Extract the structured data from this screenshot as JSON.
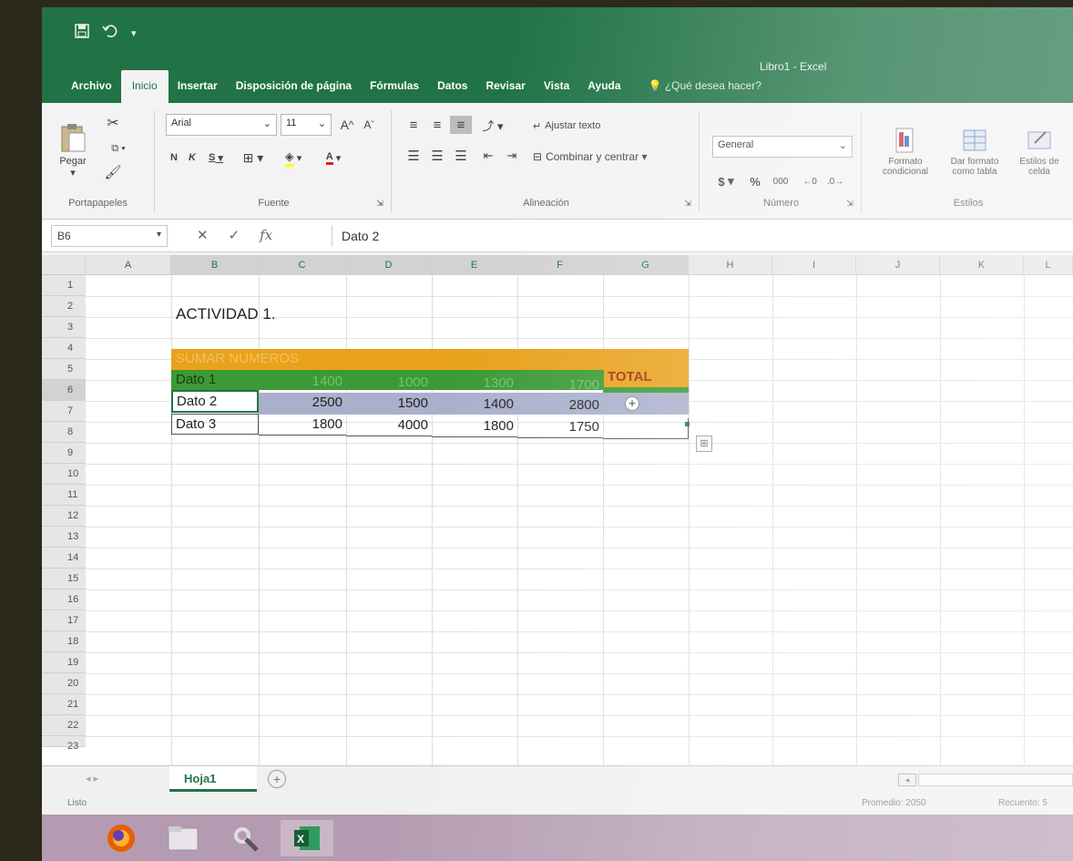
{
  "app": {
    "doc_title": "Libro1 - Excel"
  },
  "qat": {
    "save_icon": "save-icon",
    "undo_icon": "undo-icon"
  },
  "tabs": [
    {
      "label": "Archivo"
    },
    {
      "label": "Inicio"
    },
    {
      "label": "Insertar"
    },
    {
      "label": "Disposición de página"
    },
    {
      "label": "Fórmulas"
    },
    {
      "label": "Datos"
    },
    {
      "label": "Revisar"
    },
    {
      "label": "Vista"
    },
    {
      "label": "Ayuda"
    }
  ],
  "tell_me": "¿Qué desea hacer?",
  "ribbon": {
    "clipboard": {
      "label": "Portapapeles",
      "paste": "Pegar"
    },
    "font": {
      "label": "Fuente",
      "name": "Arial",
      "size": "11",
      "bold": "N",
      "italic": "K",
      "underline": "S"
    },
    "alignment": {
      "label": "Alineación",
      "wrap": "Ajustar texto",
      "merge": "Combinar y centrar"
    },
    "number": {
      "label": "Número",
      "format": "General",
      "currency": "$",
      "percent": "%",
      "thousands": "000"
    },
    "styles": {
      "label": "Estilos",
      "conditional": "Formato condicional",
      "as_table": "Dar formato como tabla",
      "cell": "Estilos de celda"
    }
  },
  "formula_bar": {
    "name_box": "B6",
    "formula": "Dato 2"
  },
  "columns": [
    "A",
    "B",
    "C",
    "D",
    "E",
    "F",
    "G",
    "H",
    "I",
    "J",
    "K",
    "L"
  ],
  "rows": [
    "1",
    "2",
    "3",
    "4",
    "5",
    "6",
    "7",
    "8",
    "9",
    "10",
    "11",
    "12",
    "13",
    "14",
    "15",
    "16",
    "17",
    "18",
    "19",
    "20",
    "21",
    "22",
    "23"
  ],
  "sheet": {
    "title": "ACTIVIDAD 1.",
    "header": "SUMAR NUMEROS",
    "total_label": "TOTAL",
    "rows": [
      {
        "label": "Dato 1",
        "values": [
          "1400",
          "1000",
          "1300",
          "1700"
        ]
      },
      {
        "label": "Dato 2",
        "values": [
          "2500",
          "1500",
          "1400",
          "2800"
        ]
      },
      {
        "label": "Dato 3",
        "values": [
          "1800",
          "4000",
          "1800",
          "1750"
        ]
      }
    ]
  },
  "colors": {
    "excel_green": "#217346",
    "header_orange": "#e8a21c",
    "row1_green": "#3c9a35",
    "row2_lavender": "#aab0cc"
  },
  "sheet_tab": "Hoja1",
  "status": {
    "ready": "Listo",
    "average": "Promedio: 2050",
    "count": "Recuento: 5"
  },
  "taskbar": [
    "firefox-icon",
    "files-icon",
    "settings-icon",
    "excel-icon"
  ]
}
